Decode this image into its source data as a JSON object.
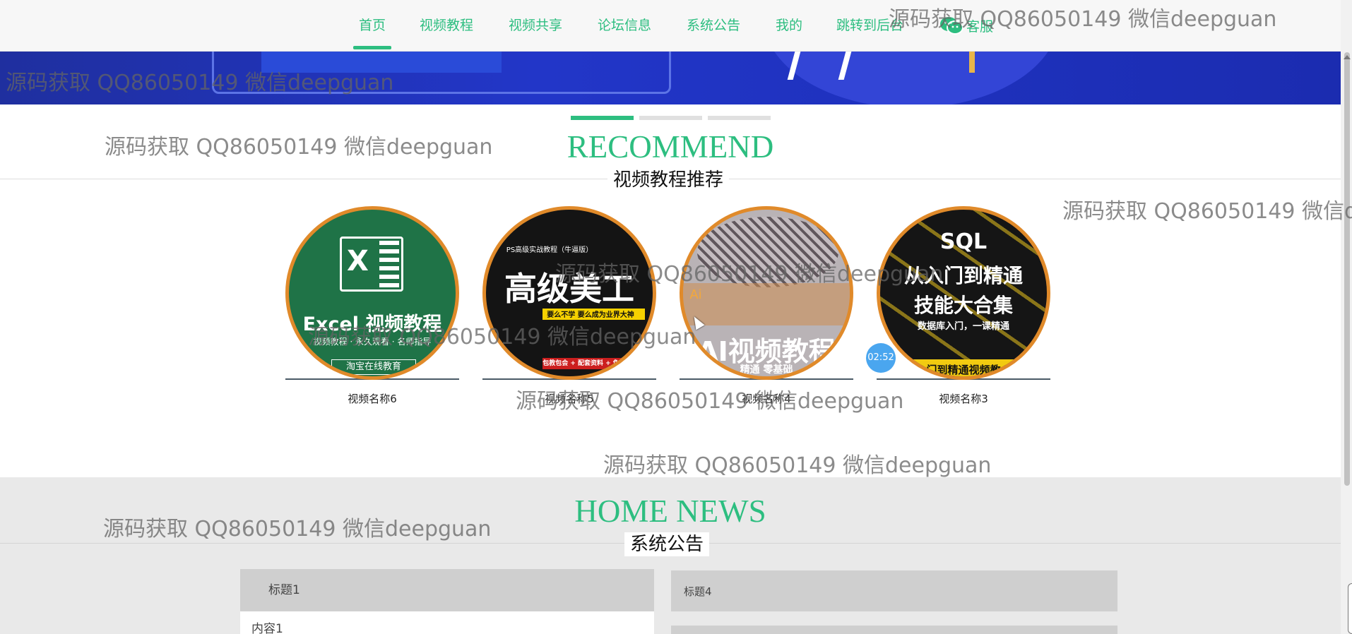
{
  "nav": {
    "items": [
      "首页",
      "视频教程",
      "视频共享",
      "论坛信息",
      "系统公告",
      "我的",
      "跳转到后台"
    ],
    "active_index": 0,
    "kefu_label": "客服",
    "kefu_icon": "wechat-icon"
  },
  "carousel": {
    "slides": 3,
    "active": 0
  },
  "recommend": {
    "title_en": "RECOMMEND",
    "title_cn": "视频教程推荐",
    "cards": [
      {
        "name": "视频名称6",
        "thumb_title": "Excel 视频教程",
        "thumb_sub": "视频教程 · 永久观看 · 名师指导",
        "thumb_tag": "淘宝在线教育"
      },
      {
        "name": "视频名称5",
        "thumb_top": "PS高级实战教程（牛逼版）",
        "thumb_title": "高级美工",
        "thumb_sub": "要么不学 要么成为业界大神",
        "thumb_tag": "包教包会 + 配套资料 + 免费答疑"
      },
      {
        "name": "视频名称4",
        "thumb_top": "Ai",
        "thumb_title": "AI视频教程",
        "thumb_sub": "精通 零基础"
      },
      {
        "name": "视频名称3",
        "thumb_title": "SQL",
        "thumb_title2": "从入门到精通",
        "thumb_title3": "技能大合集",
        "thumb_sub": "数据库入门，一课精通",
        "thumb_tag": "门到精通视频教"
      }
    ],
    "timer": "02:52"
  },
  "news": {
    "title_en": "HOME NEWS",
    "title_cn": "系统公告",
    "items": [
      {
        "title": "标题1",
        "content": "内容1"
      },
      {
        "title": "标题4"
      }
    ]
  },
  "watermarks": [
    "源码获取 QQ86050149 微信deepguan",
    "源码获取 QQ86050149 微信deepguan",
    "源码获取 QQ86050149 微信deepguan",
    "源码获取 QQ86050149 微信d",
    "源码获取 QQ86050149 微信deepguan",
    "源码获取 QQ86050149 微信deepguan",
    "源码获取 QQ86050149 微信deepguan",
    "源码获取 QQ86050149 微信deepguan",
    "源码获取 QQ86050149 微信deepguan"
  ],
  "colors": {
    "accent": "#2dbe80",
    "ring": "#e08a2a",
    "news_bg": "#e9e9e9"
  }
}
